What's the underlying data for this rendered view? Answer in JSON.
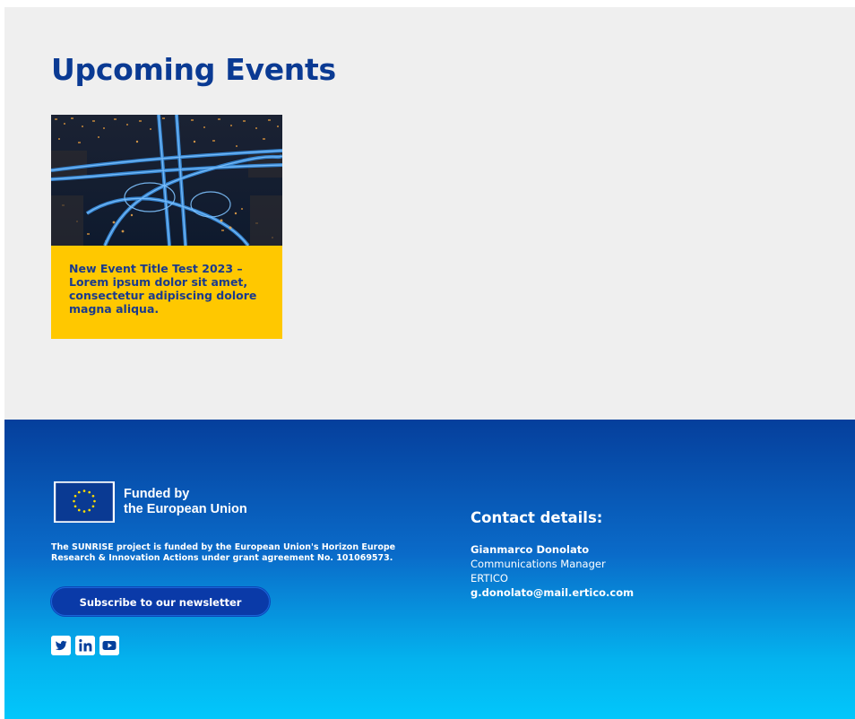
{
  "events_section": {
    "title": "Upcoming Events",
    "events": [
      {
        "image_icon": "city-highway-night-photo",
        "title": "New Event Title Test 2023 – Lorem ipsum dolor sit amet, consectetur adipiscing dolore magna aliqua."
      }
    ]
  },
  "footer": {
    "eu_logo": {
      "line1": "Funded by",
      "line2": "the European Union",
      "icon": "eu-flag-icon"
    },
    "funding_text": "The SUNRISE project is funded by the European Union's Horizon Europe Research & Innovation Actions under grant agreement No. 101069573.",
    "newsletter_button": "Subscribe to our newsletter",
    "social": [
      {
        "name": "twitter-icon"
      },
      {
        "name": "linkedin-icon"
      },
      {
        "name": "youtube-icon"
      }
    ],
    "contact": {
      "heading": "Contact details:",
      "name": "Gianmarco Donolato",
      "role": "Communications Manager",
      "org": "ERTICO",
      "email": "g.donolato@mail.ertico.com"
    }
  },
  "colors": {
    "title_blue": "#0a3a93",
    "event_yellow": "#ffc800",
    "footer_top": "#053f9c",
    "footer_bottom": "#02c7fb"
  }
}
